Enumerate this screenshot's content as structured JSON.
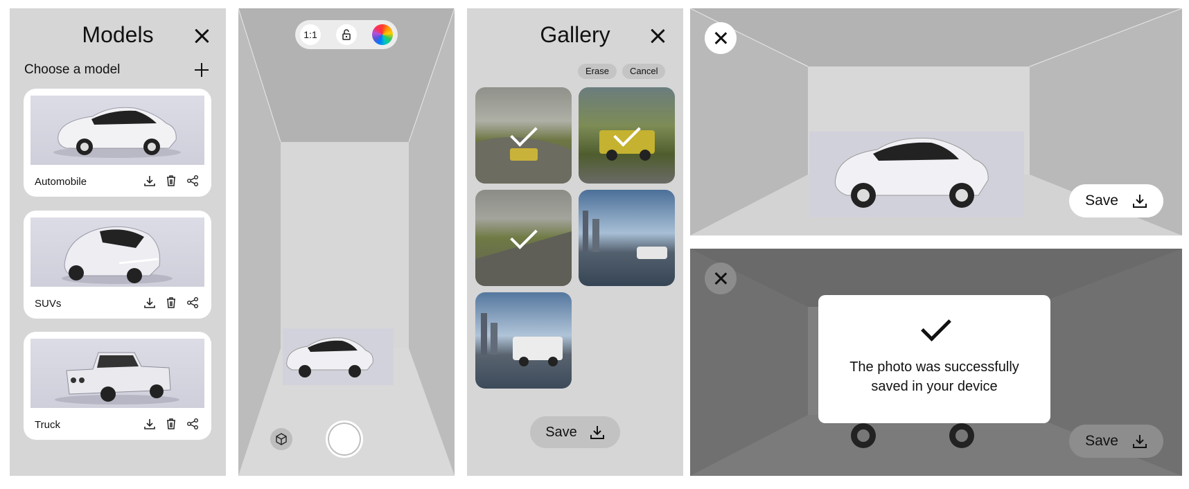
{
  "models_screen": {
    "title": "Models",
    "subtitle": "Choose a model",
    "cards": [
      {
        "label": "Automobile"
      },
      {
        "label": "SUVs"
      },
      {
        "label": "Truck"
      }
    ]
  },
  "camera_screen": {
    "aspect_ratio_label": "1:1",
    "icons": [
      "lock-icon",
      "color-wheel-icon",
      "cube-icon",
      "shutter-button"
    ]
  },
  "gallery_screen": {
    "title": "Gallery",
    "erase_label": "Erase",
    "cancel_label": "Cancel",
    "save_label": "Save",
    "images": [
      {
        "subject": "yellow truck on road",
        "selected": true
      },
      {
        "subject": "yellow truck on hillside",
        "selected": true
      },
      {
        "subject": "empty road",
        "selected": true
      },
      {
        "subject": "car city skyline",
        "selected": false
      },
      {
        "subject": "truck city skyline",
        "selected": false
      }
    ]
  },
  "preview_screen": {
    "save_label": "Save"
  },
  "saved_screen": {
    "save_label": "Save",
    "message": "The photo was successfully saved in your device"
  },
  "colors": {
    "panel_bg": "#d6d6d6",
    "card_bg": "#ffffff",
    "dark_overlay": "#6f6f6f",
    "accent_text": "#111111"
  }
}
